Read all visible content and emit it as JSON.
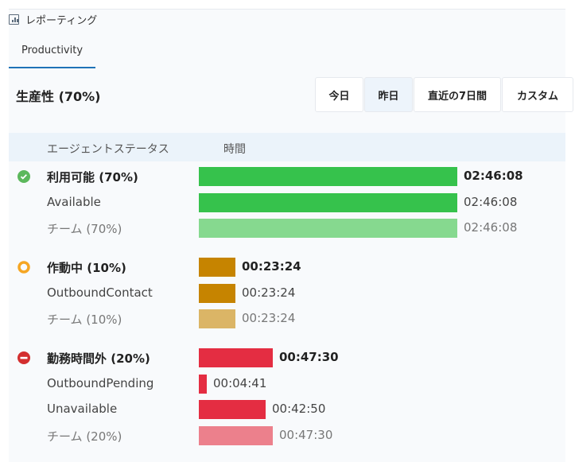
{
  "header": {
    "icon": "bar-chart-icon",
    "title": "レポーティング"
  },
  "tabs": [
    {
      "label": "Productivity",
      "active": true
    }
  ],
  "page_title": "生産性 (70%)",
  "range_buttons": [
    {
      "label": "今日",
      "active": false
    },
    {
      "label": "昨日",
      "active": true
    },
    {
      "label": "直近の7日間",
      "active": false
    },
    {
      "label": "カスタム",
      "active": false
    }
  ],
  "table_header": {
    "status": "エージェントステータス",
    "time": "時間"
  },
  "groups": [
    {
      "icon": "check-circle-icon",
      "color": "#36c24c",
      "team_color": "#86d98f",
      "rows": [
        {
          "kind": "main",
          "label": "利用可能 (70%)",
          "time": "02:46:08",
          "seconds": 9968
        },
        {
          "kind": "sub",
          "label": "Available",
          "time": "02:46:08",
          "seconds": 9968
        },
        {
          "kind": "team",
          "label": "チーム (70%)",
          "time": "02:46:08",
          "seconds": 9968
        }
      ]
    },
    {
      "icon": "busy-circle-icon",
      "color": "#c68400",
      "team_color": "#dbb566",
      "rows": [
        {
          "kind": "main",
          "label": "作動中 (10%)",
          "time": "00:23:24",
          "seconds": 1404
        },
        {
          "kind": "sub",
          "label": "OutboundContact",
          "time": "00:23:24",
          "seconds": 1404
        },
        {
          "kind": "team",
          "label": "チーム (10%)",
          "time": "00:23:24",
          "seconds": 1404
        }
      ]
    },
    {
      "icon": "minus-circle-icon",
      "color": "#e42d42",
      "team_color": "#ec808c",
      "rows": [
        {
          "kind": "main",
          "label": "勤務時間外 (20%)",
          "time": "00:47:30",
          "seconds": 2850
        },
        {
          "kind": "sub",
          "label": "OutboundPending",
          "time": "00:04:41",
          "seconds": 281
        },
        {
          "kind": "sub",
          "label": "Unavailable",
          "time": "00:42:50",
          "seconds": 2570
        },
        {
          "kind": "team",
          "label": "チーム (20%)",
          "time": "00:47:30",
          "seconds": 2850
        }
      ]
    }
  ]
}
